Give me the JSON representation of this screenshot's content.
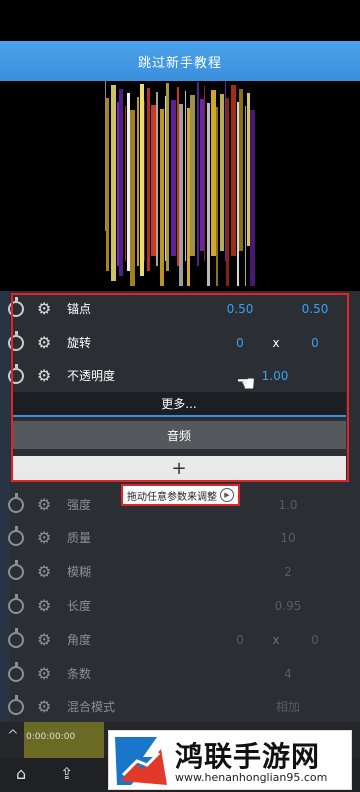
{
  "banner": {
    "title": "跳过新手教程"
  },
  "panel": {
    "rows_active": [
      {
        "label": "锚点",
        "v1": "0.50",
        "x": "",
        "v2": "0.50"
      },
      {
        "label": "旋转",
        "v1": "0",
        "x": "x",
        "v2": "0"
      },
      {
        "label": "不透明度",
        "v1": "1.00",
        "x": "",
        "v2": ""
      }
    ],
    "more_label": "更多...",
    "audio_label": "音频",
    "add_label": "+",
    "rows_dim": [
      {
        "label": "强度",
        "v1": "1.0",
        "x": "",
        "v2": ""
      },
      {
        "label": "质量",
        "v1": "10",
        "x": "",
        "v2": ""
      },
      {
        "label": "模糊",
        "v1": "2",
        "x": "",
        "v2": ""
      },
      {
        "label": "长度",
        "v1": "0.95",
        "x": "",
        "v2": ""
      },
      {
        "label": "角度",
        "v1": "0",
        "x": "x",
        "v2": "0"
      },
      {
        "label": "条数",
        "v1": "4",
        "x": "",
        "v2": ""
      },
      {
        "label": "混合模式",
        "v1": "相加",
        "x": "",
        "v2": ""
      }
    ]
  },
  "hint": {
    "text": "拖动任意参数来调整"
  },
  "timeline": {
    "time": "0:00:00:00"
  },
  "watermark": {
    "title": "鸿联手游网",
    "url": "www.henanhonglian95.com"
  },
  "colors": {
    "accent": "#3da0ef",
    "banner": "#4aa3ea",
    "highlight": "#e0242a",
    "panel": "#2b2e33"
  }
}
